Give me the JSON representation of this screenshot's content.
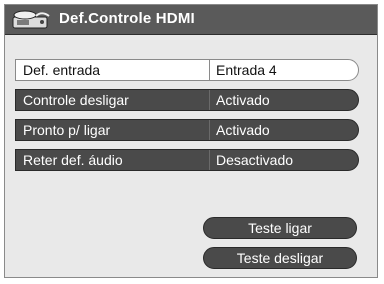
{
  "header": {
    "title": "Def.Controle HDMI",
    "icon": "hdmi-device-icon"
  },
  "settings": [
    {
      "label": "Def. entrada",
      "value": "Entrada 4",
      "selected": true
    },
    {
      "label": "Controle desligar",
      "value": "Activado",
      "selected": false
    },
    {
      "label": "Pronto p/ ligar",
      "value": "Activado",
      "selected": false
    },
    {
      "label": "Reter def. áudio",
      "value": "Desactivado",
      "selected": false
    }
  ],
  "buttons": {
    "test_on": "Teste ligar",
    "test_off": "Teste desligar"
  },
  "colors": {
    "title_bar": "#5a5a5a",
    "row_normal": "#4a4a4a",
    "row_selected": "#ffffff",
    "panel_bg": "#e9e9e9"
  }
}
